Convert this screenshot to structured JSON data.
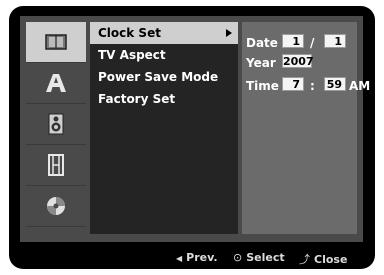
{
  "sidebar": {
    "items": [
      {
        "icon": "book-icon",
        "active": true
      },
      {
        "icon": "language-a-icon",
        "active": false
      },
      {
        "icon": "speaker-icon",
        "active": false
      },
      {
        "icon": "film-icon",
        "active": false
      },
      {
        "icon": "disc-icon",
        "active": false
      }
    ]
  },
  "menu": {
    "items": [
      {
        "label": "Clock Set"
      },
      {
        "label": "TV Aspect"
      },
      {
        "label": "Power Save Mode"
      },
      {
        "label": "Factory Set"
      }
    ]
  },
  "clock": {
    "date_label": "Date",
    "month": "1",
    "date_sep": "/",
    "day": "1",
    "year_label": "Year",
    "year": "2007",
    "time_label": "Time",
    "hour": "7",
    "time_sep": ":",
    "minute": "59",
    "ampm": "AM"
  },
  "footer": {
    "prev_icon": "◀",
    "prev_label": "Prev.",
    "select_icon": "⊙",
    "select_label": "Select",
    "close_icon": "⤴",
    "close_label": "Close"
  }
}
